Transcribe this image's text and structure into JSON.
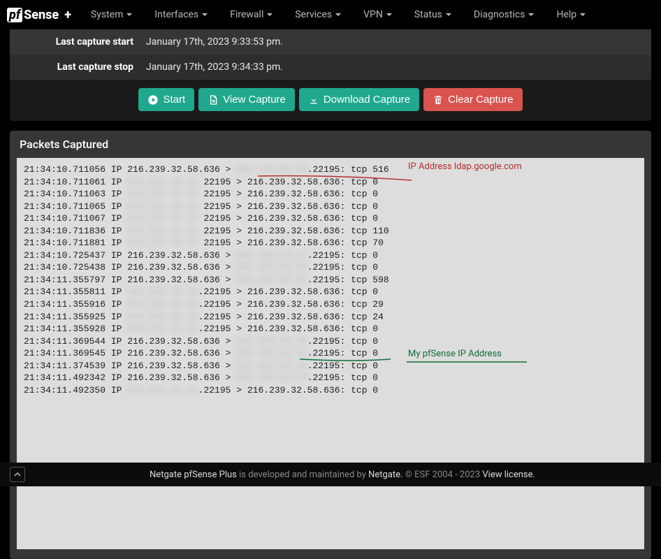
{
  "nav": {
    "logo_pf": "pf",
    "logo_sense": "Sense",
    "logo_plus": "+",
    "items": [
      {
        "label": "System"
      },
      {
        "label": "Interfaces"
      },
      {
        "label": "Firewall"
      },
      {
        "label": "Services"
      },
      {
        "label": "VPN"
      },
      {
        "label": "Status"
      },
      {
        "label": "Diagnostics"
      },
      {
        "label": "Help"
      }
    ]
  },
  "capture_info": {
    "start_label": "Last capture start",
    "start_value": "January 17th, 2023 9:33:53 pm.",
    "stop_label": "Last capture stop",
    "stop_value": "January 17th, 2023 9:34:33 pm."
  },
  "buttons": {
    "start": "Start",
    "view": "View Capture",
    "download": "Download Capture",
    "clear": "Clear Capture"
  },
  "packets": {
    "header": "Packets Captured",
    "redacted_placeholder": "XXX.XXX.XX.XX",
    "lines": [
      {
        "time": "21:34:10.711056",
        "proto": "IP",
        "src": "216.239.32.58.636",
        "dst_redacted": true,
        "dst": ".22195",
        "tail": "tcp 516"
      },
      {
        "time": "21:34:10.711061",
        "proto": "IP",
        "src_redacted": true,
        "src": "22195",
        "dst": "216.239.32.58.636",
        "tail": "tcp 0"
      },
      {
        "time": "21:34:10.711063",
        "proto": "IP",
        "src_redacted": true,
        "src": "22195",
        "dst": "216.239.32.58.636",
        "tail": "tcp 0"
      },
      {
        "time": "21:34:10.711065",
        "proto": "IP",
        "src_redacted": true,
        "src": "22195",
        "dst": "216.239.32.58.636",
        "tail": "tcp 0"
      },
      {
        "time": "21:34:10.711067",
        "proto": "IP",
        "src_redacted": true,
        "src": "22195",
        "dst": "216.239.32.58.636",
        "tail": "tcp 0"
      },
      {
        "time": "21:34:10.711836",
        "proto": "IP",
        "src_redacted": true,
        "src": "22195",
        "dst": "216.239.32.58.636",
        "tail": "tcp 110"
      },
      {
        "time": "21:34:10.711881",
        "proto": "IP",
        "src_redacted": true,
        "src": "22195",
        "dst": "216.239.32.58.636",
        "tail": "tcp 70"
      },
      {
        "time": "21:34:10.725437",
        "proto": "IP",
        "src": "216.239.32.58.636",
        "dst_redacted": true,
        "dst": ".22195",
        "tail": "tcp 0"
      },
      {
        "time": "21:34:10.725438",
        "proto": "IP",
        "src": "216.239.32.58.636",
        "dst_redacted": true,
        "dst": ".22195",
        "tail": "tcp 0"
      },
      {
        "time": "21:34:11.355797",
        "proto": "IP",
        "src": "216.239.32.58.636",
        "dst_redacted": true,
        "dst": ".22195",
        "tail": "tcp 598"
      },
      {
        "time": "21:34:11.355811",
        "proto": "IP",
        "src_redacted": true,
        "src": ".22195",
        "dst": "216.239.32.58.636",
        "tail": "tcp 0"
      },
      {
        "time": "21:34:11.355916",
        "proto": "IP",
        "src_redacted": true,
        "src": ".22195",
        "dst": "216.239.32.58.636",
        "tail": "tcp 29"
      },
      {
        "time": "21:34:11.355925",
        "proto": "IP",
        "src_redacted": true,
        "src": ".22195",
        "dst": "216.239.32.58.636",
        "tail": "tcp 24"
      },
      {
        "time": "21:34:11.355928",
        "proto": "IP",
        "src_redacted": true,
        "src": ".22195",
        "dst": "216.239.32.58.636",
        "tail": "tcp 0"
      },
      {
        "time": "21:34:11.369544",
        "proto": "IP",
        "src": "216.239.32.58.636",
        "dst_redacted": true,
        "dst": ".22195",
        "tail": "tcp 0"
      },
      {
        "time": "21:34:11.369545",
        "proto": "IP",
        "src": "216.239.32.58.636",
        "dst_redacted": true,
        "dst": ".22195",
        "tail": "tcp 0"
      },
      {
        "time": "21:34:11.374539",
        "proto": "IP",
        "src": "216.239.32.58.636",
        "dst_redacted": true,
        "dst": ".22195",
        "tail": "tcp 0"
      },
      {
        "time": "21:34:11.492342",
        "proto": "IP",
        "src": "216.239.32.58.636",
        "dst_redacted": true,
        "dst": ".22195",
        "tail": "tcp 0"
      },
      {
        "time": "21:34:11.492350",
        "proto": "IP",
        "src_redacted": true,
        "src": ".22195",
        "dst": "216.239.32.58.636",
        "tail": "tcp 0"
      }
    ],
    "annotations": {
      "red_label": "IP Address ldap.google.com",
      "green_label": "My pfSense IP Address"
    }
  },
  "footer": {
    "prefix": "Netgate pfSense Plus",
    "middle": " is developed and maintained by ",
    "netgate": "Netgate.",
    "copyright": " © ESF 2004 - 2023 ",
    "license": "View license."
  }
}
